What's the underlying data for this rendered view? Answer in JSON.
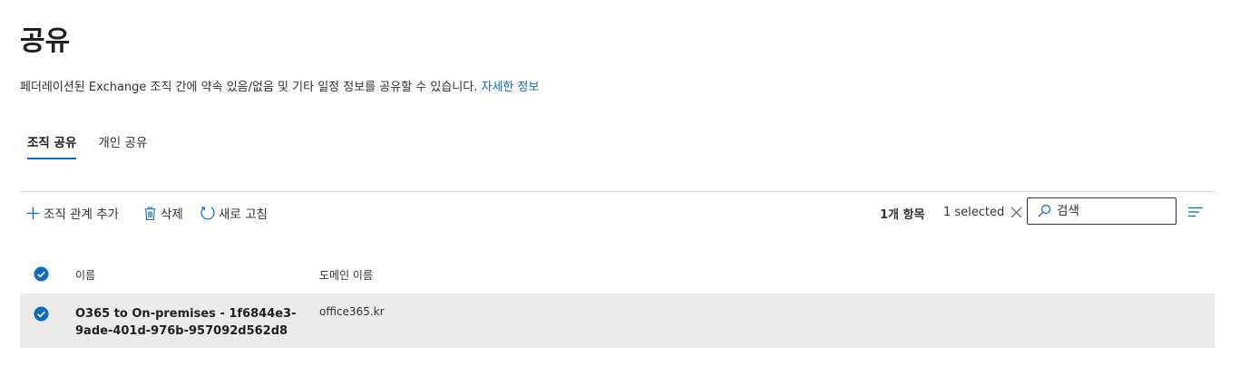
{
  "page": {
    "title": "공유",
    "description": "페더레이션된 Exchange 조직 간에 약속 있음/없음 및 기타 일정 정보를 공유할 수 있습니다.",
    "learn_more": "자세한 정보"
  },
  "tabs": [
    {
      "label": "조직 공유",
      "active": true
    },
    {
      "label": "개인 공유",
      "active": false
    }
  ],
  "toolbar": {
    "add_label": "조직 관계 추가",
    "delete_label": "삭제",
    "refresh_label": "새로 고침",
    "item_count": "1개 항목",
    "selected_text": "1 selected",
    "search_placeholder": "검색"
  },
  "table": {
    "columns": [
      "이름",
      "도메인 이름"
    ],
    "rows": [
      {
        "name": "O365 to On-premises - 1f6844e3-9ade-401d-976b-957092d562d8",
        "domain": "office365.kr",
        "selected": true
      }
    ]
  },
  "colors": {
    "accent": "#0f6cbd",
    "selected_row": "#edebe9",
    "divider": "#e1dfdd"
  },
  "icons": [
    "plus-icon",
    "trash-icon",
    "refresh-icon",
    "close-icon",
    "search-icon",
    "filter-icon",
    "checkmark-icon"
  ]
}
